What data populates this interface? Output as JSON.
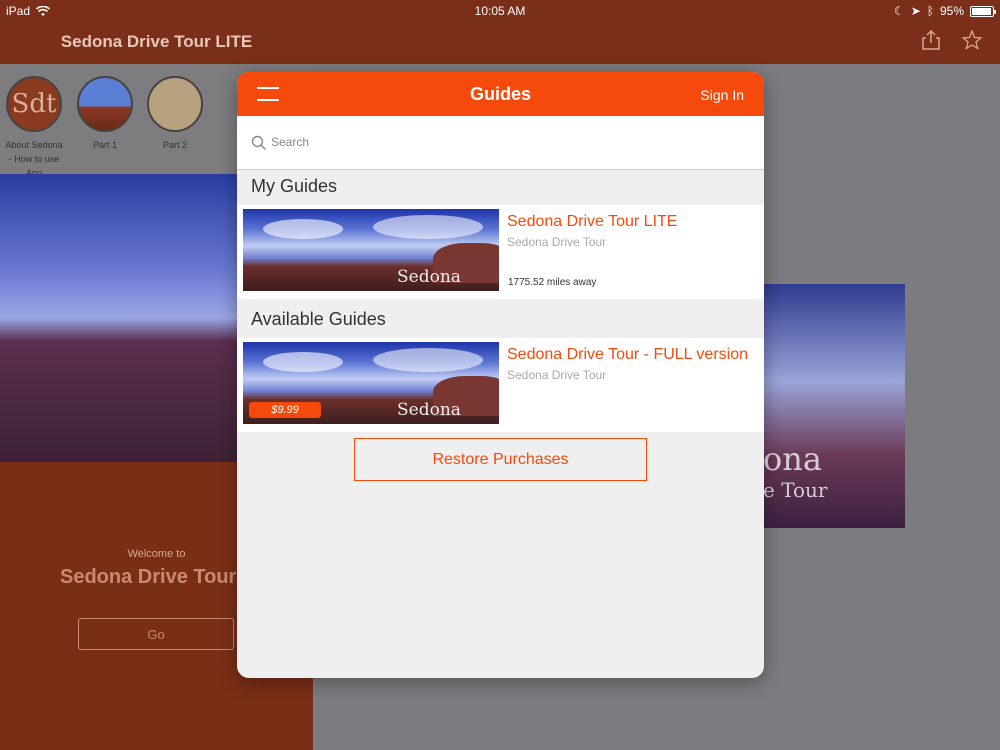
{
  "statusbar": {
    "device": "iPad",
    "time": "10:05 AM",
    "battery": "95%",
    "battery_level": 0.95
  },
  "background_left": {
    "nav_title": "Sedona Drive Tour LITE",
    "thumbs": [
      {
        "label": "About Sedona - How to use App",
        "logo_text": "Sdt"
      },
      {
        "label": "Part 1"
      },
      {
        "label": "Part 2"
      }
    ],
    "welcome_text": "Welcome to",
    "welcome_title": "Sedona Drive Tour LITE",
    "go_label": "Go"
  },
  "background_right": {
    "hero_text_1": "ona",
    "hero_text_2": "e Tour"
  },
  "modal": {
    "title": "Guides",
    "sign_in": "Sign In",
    "search_placeholder": "Search",
    "my_guides_header": "My Guides",
    "available_guides_header": "Available Guides",
    "my_guides": [
      {
        "title": "Sedona Drive Tour LITE",
        "subtitle": "Sedona Drive Tour",
        "distance": "1775.52 miles away",
        "image_text": "Sedona"
      }
    ],
    "available_guides": [
      {
        "title": "Sedona Drive Tour - FULL version",
        "subtitle": "Sedona Drive Tour",
        "price": "$9.99",
        "image_text": "Sedona"
      }
    ],
    "restore_label": "Restore Purchases"
  },
  "colors": {
    "accent": "#f54a0c",
    "background_brown": "#7a2e16"
  }
}
